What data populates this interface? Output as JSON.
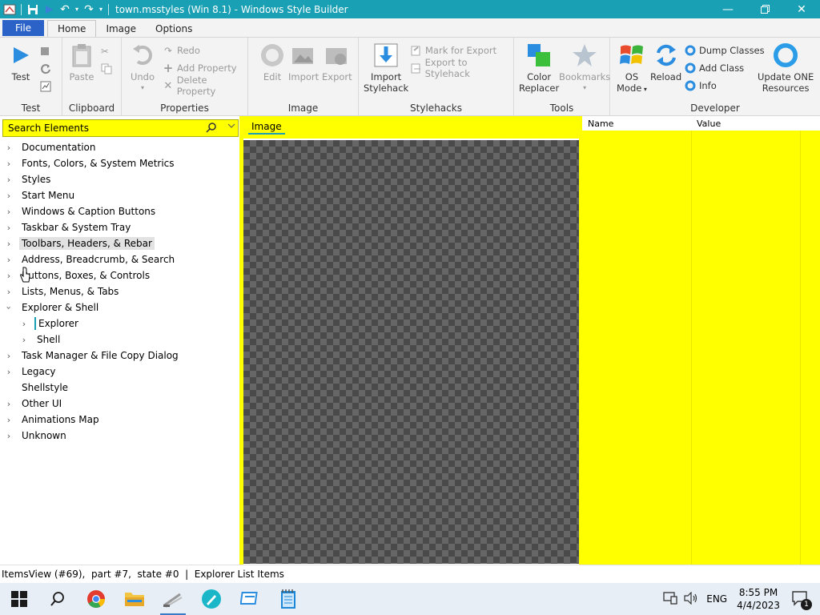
{
  "app": {
    "title": "town.msstyles (Win 8.1) - Windows Style Builder"
  },
  "menu": {
    "file": "File",
    "tabs": [
      "Home",
      "Image",
      "Options"
    ],
    "active_tab": "Home"
  },
  "ribbon": {
    "test": {
      "label": "Test",
      "group": "Test"
    },
    "clipboard": {
      "paste": "Paste",
      "group": "Clipboard"
    },
    "properties": {
      "undo": "Undo",
      "redo": "Redo",
      "add_property": "Add Property",
      "delete_property": "Delete Property",
      "group": "Properties"
    },
    "image": {
      "edit": "Edit",
      "import": "Import",
      "export": "Export",
      "group": "Image"
    },
    "stylehacks": {
      "import_line1": "Import",
      "import_line2": "Stylehack",
      "mark_for_export": "Mark for Export",
      "export_to_stylehack": "Export to Stylehack",
      "group": "Stylehacks"
    },
    "tools": {
      "color_line1": "Color",
      "color_line2": "Replacer",
      "bookmarks": "Bookmarks",
      "group": "Tools"
    },
    "developer": {
      "os_line1": "OS",
      "os_line2": "Mode",
      "reload": "Reload",
      "dump_classes": "Dump Classes",
      "add_class": "Add Class",
      "info": "Info",
      "update_line1": "Update ONE",
      "update_line2": "Resources",
      "group": "Developer"
    }
  },
  "search": {
    "placeholder": "Search Elements"
  },
  "tree": {
    "items": [
      {
        "label": "Documentation",
        "expanded": false
      },
      {
        "label": "Fonts, Colors, & System Metrics",
        "expanded": false
      },
      {
        "label": "Styles",
        "expanded": false
      },
      {
        "label": "Start Menu",
        "expanded": false
      },
      {
        "label": "Windows & Caption Buttons",
        "expanded": false
      },
      {
        "label": "Taskbar & System Tray",
        "expanded": false
      },
      {
        "label": "Toolbars, Headers, & Rebar",
        "expanded": false
      },
      {
        "label": "Address, Breadcrumb, & Search",
        "expanded": false
      },
      {
        "label": "Buttons, Boxes, & Controls",
        "expanded": false
      },
      {
        "label": "Lists, Menus, & Tabs",
        "expanded": false
      },
      {
        "label": "Explorer & Shell",
        "expanded": true
      },
      {
        "label": "Explorer",
        "expanded": false
      },
      {
        "label": "Shell",
        "expanded": false
      },
      {
        "label": "Task Manager & File Copy Dialog",
        "expanded": false
      },
      {
        "label": "Legacy",
        "expanded": false
      },
      {
        "label": "Shellstyle",
        "expanded": false
      },
      {
        "label": "Other UI",
        "expanded": false
      },
      {
        "label": "Animations Map",
        "expanded": false
      },
      {
        "label": "Unknown",
        "expanded": false
      }
    ]
  },
  "image_panel": {
    "tab": "Image"
  },
  "properties_panel": {
    "col_name": "Name",
    "col_value": "Value"
  },
  "status": {
    "text": "ItemsView (#69),  part #7,  state #0  |  Explorer List Items"
  },
  "taskbar": {
    "lang": "ENG",
    "time": "8:55 PM",
    "date": "4/4/2023",
    "notification_count": "1"
  }
}
